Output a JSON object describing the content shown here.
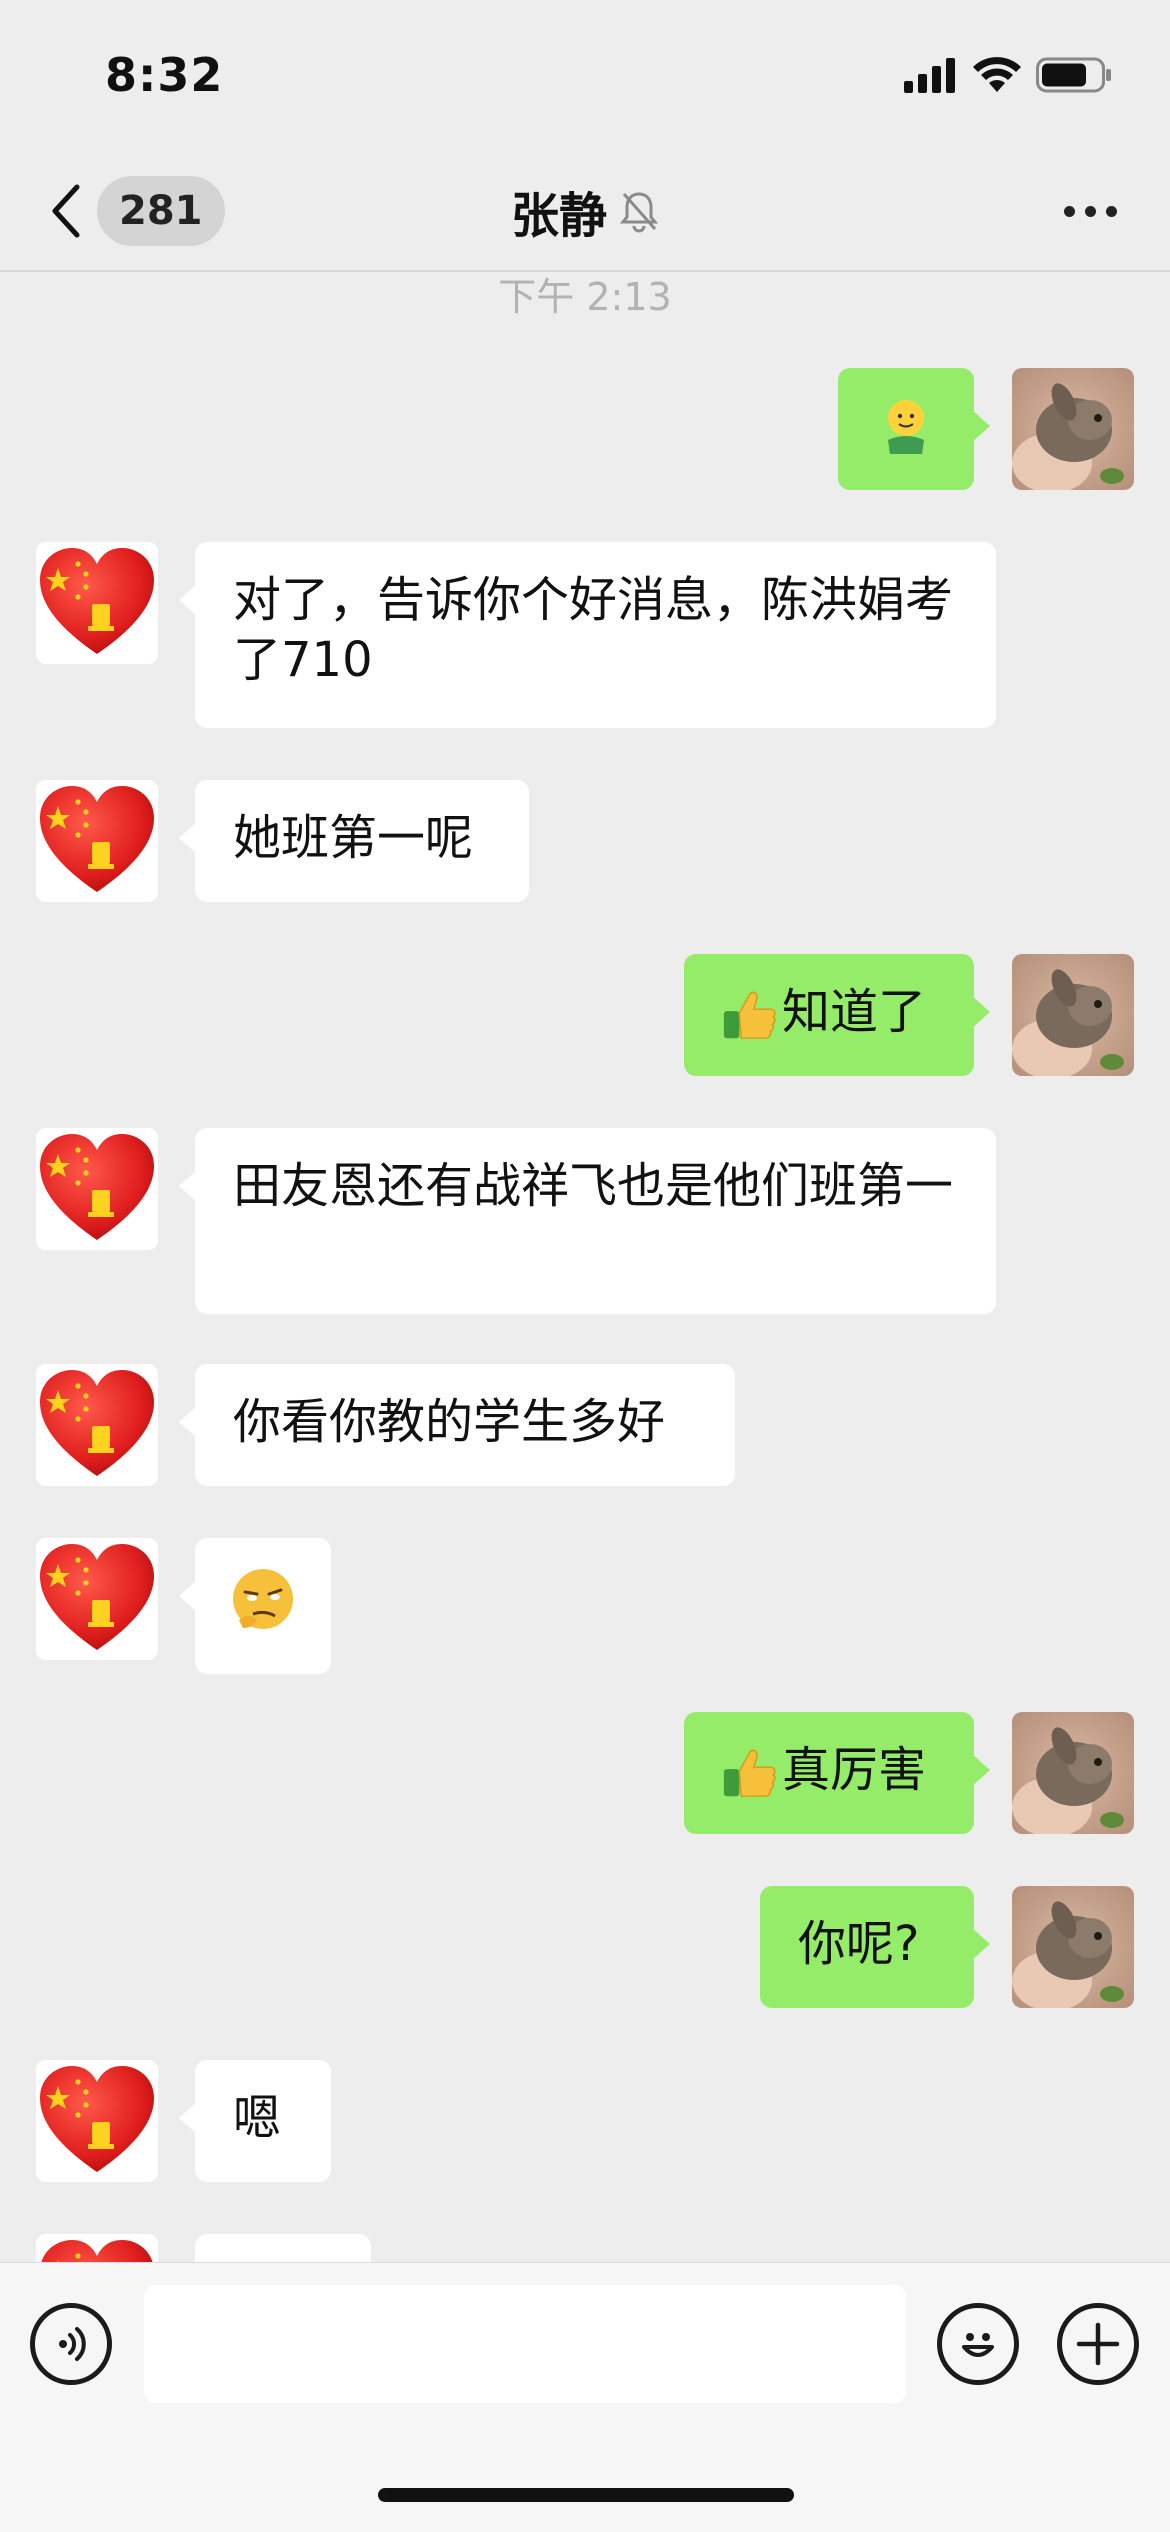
{
  "status_bar": {
    "time": "8:32"
  },
  "nav": {
    "unread_count": "281",
    "title": "张静"
  },
  "chat": {
    "time_separator": "下午 2:13",
    "messages": [
      {
        "side": "right",
        "type": "sticker",
        "text": ""
      },
      {
        "side": "left",
        "type": "text",
        "text": "对了，告诉你个好消息，陈洪娟考了710"
      },
      {
        "side": "left",
        "type": "text",
        "text": "她班第一呢"
      },
      {
        "side": "right",
        "type": "text",
        "emoji": "thumbs-up",
        "text": "知道了"
      },
      {
        "side": "left",
        "type": "text",
        "text": "田友恩还有战祥飞也是他们班第一"
      },
      {
        "side": "left",
        "type": "text",
        "text": "你看你教的学生多好"
      },
      {
        "side": "left",
        "type": "sticker",
        "text": ""
      },
      {
        "side": "right",
        "type": "text",
        "emoji": "thumbs-up",
        "text": "真厉害"
      },
      {
        "side": "right",
        "type": "text",
        "text": "你呢?"
      },
      {
        "side": "left",
        "type": "text",
        "text": "嗯"
      }
    ]
  },
  "input": {
    "value": ""
  }
}
